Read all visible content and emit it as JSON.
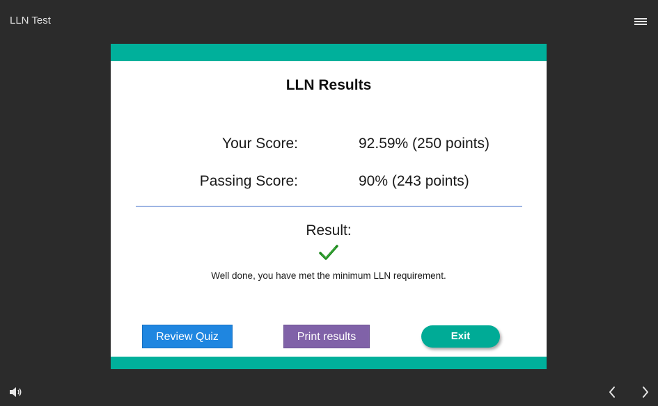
{
  "app": {
    "title": "LLN Test"
  },
  "slide": {
    "title": "LLN Results",
    "your_score_label": "Your Score:",
    "your_score_value": "92.59% (250 points)",
    "passing_score_label": "Passing Score:",
    "passing_score_value": "90% (243 points)",
    "result_label": "Result:",
    "result_icon": "checkmark-icon",
    "message": "Well done, you have met the minimum LLN requirement."
  },
  "buttons": {
    "review_label": "Review Quiz",
    "print_label": "Print results",
    "exit_label": "Exit"
  },
  "icons": {
    "menu": "hamburger-menu-icon",
    "volume": "volume-icon",
    "prev": "chevron-left-icon",
    "next": "chevron-right-icon"
  },
  "colors": {
    "accent": "#00b09b",
    "review_button": "#1f86e0",
    "print_button": "#8062a8",
    "exit_button": "#00ab96",
    "check": "#1e8a1e",
    "background": "#2b2b2b"
  }
}
